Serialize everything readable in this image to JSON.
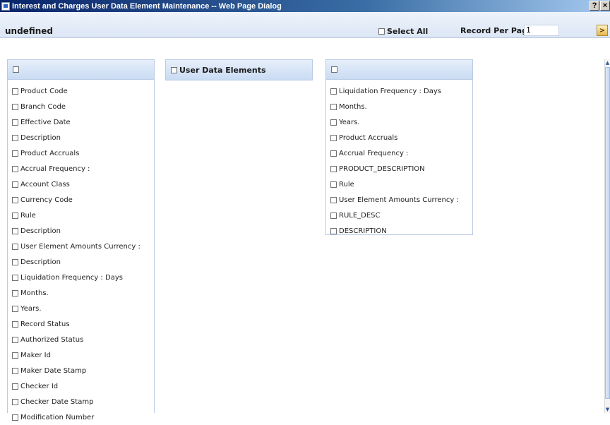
{
  "window": {
    "title": "Interest and Charges User Data Element Maintenance -- Web Page Dialog",
    "help_label": "?",
    "close_label": "×"
  },
  "header": {
    "title": "undefined",
    "select_all_label": "Select All",
    "record_per_page_label": "Record Per Page",
    "record_per_page_value": "1",
    "go_label": ">"
  },
  "left_panel": {
    "title": "",
    "items": [
      "Product Code",
      "Branch Code",
      "Effective Date",
      "Description",
      "Product Accruals",
      "Accrual Frequency :",
      "Account Class",
      "Currency Code",
      "Rule",
      "Description",
      "User Element Amounts Currency :",
      "Description",
      "Liquidation Frequency : Days",
      "Months.",
      "Years.",
      "Record Status",
      "Authorized Status",
      "Maker Id",
      "Maker Date Stamp",
      "Checker Id",
      "Checker Date Stamp",
      "Modification Number"
    ]
  },
  "middle_panel": {
    "title": "User Data Elements"
  },
  "right_panel": {
    "title": "",
    "items": [
      "Liquidation Frequency : Days",
      "Months.",
      "Years.",
      "Product Accruals",
      "Accrual Frequency :",
      "PRODUCT_DESCRIPTION",
      "Rule",
      "User Element Amounts Currency :",
      "RULE_DESC",
      "DESCRIPTION"
    ]
  },
  "scrollbar": {
    "up_icon": "arrow-up-icon",
    "down_icon": "arrow-down-icon"
  }
}
